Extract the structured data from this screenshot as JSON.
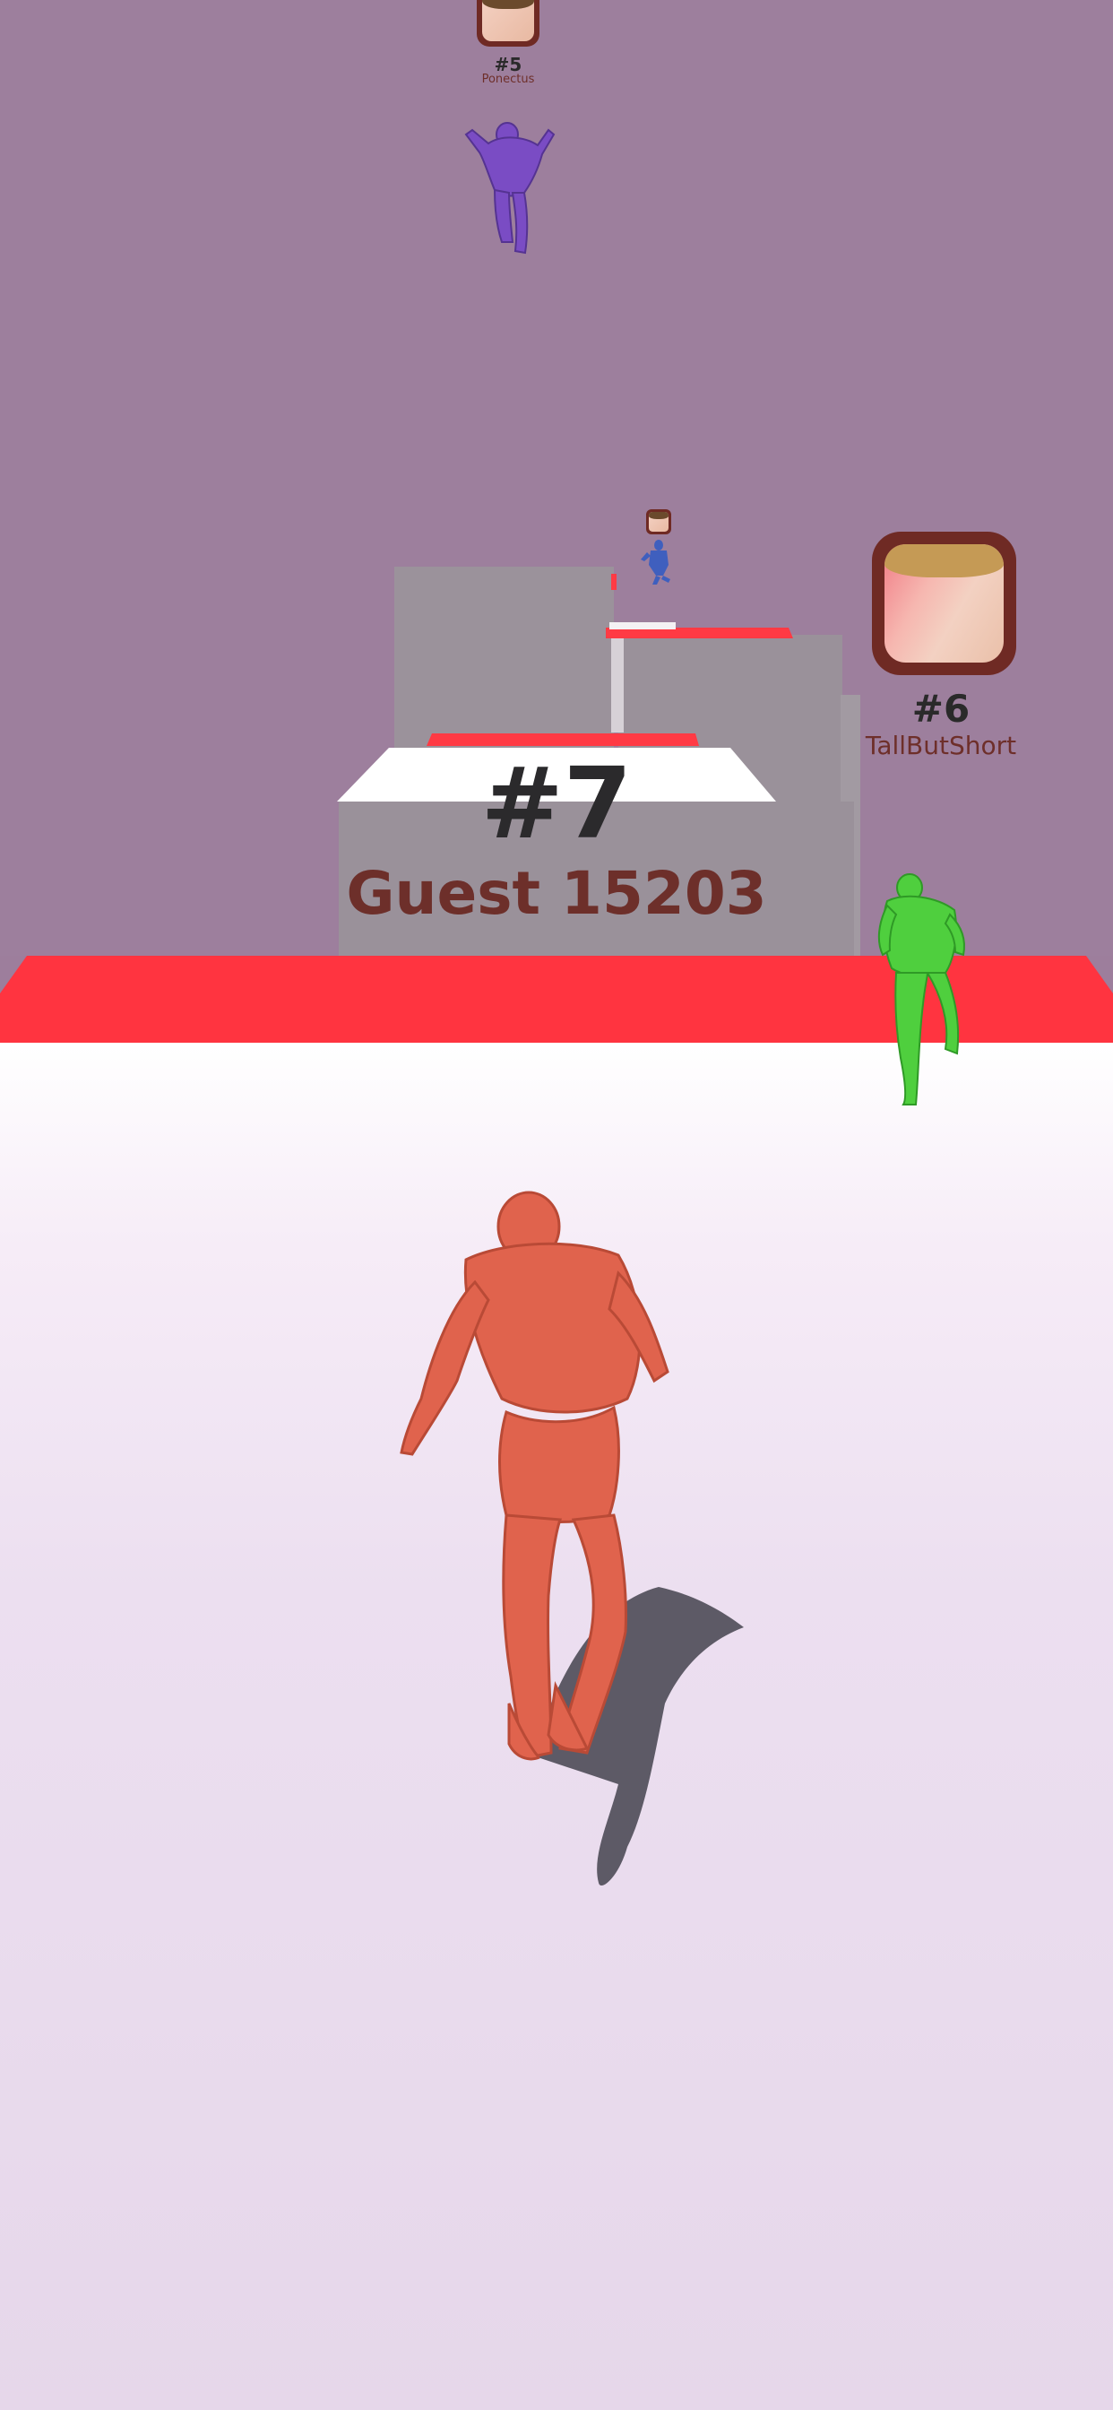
{
  "scene": {
    "colors": {
      "sky": "#9d7f9d",
      "track_edge": "#ff3440",
      "platform_top": "#ffffff",
      "platform_side": "#9a909a",
      "player": "#e0634d",
      "rival_green": "#4fcf3e",
      "rival_purple": "#7a4cc4",
      "rival_blue": "#3f5fbe",
      "avatar_frame": "#6f2a24"
    }
  },
  "players": {
    "player_label": {
      "rank": "#7",
      "name": "Guest 15203"
    },
    "rival_right": {
      "rank": "#6",
      "name": "TallButShort",
      "icon": "player-avatar-photo"
    },
    "rival_top": {
      "rank": "#5",
      "name": "Ponectus",
      "icon": "player-avatar-photo"
    },
    "rival_far": {
      "icon": "player-avatar-photo"
    }
  }
}
